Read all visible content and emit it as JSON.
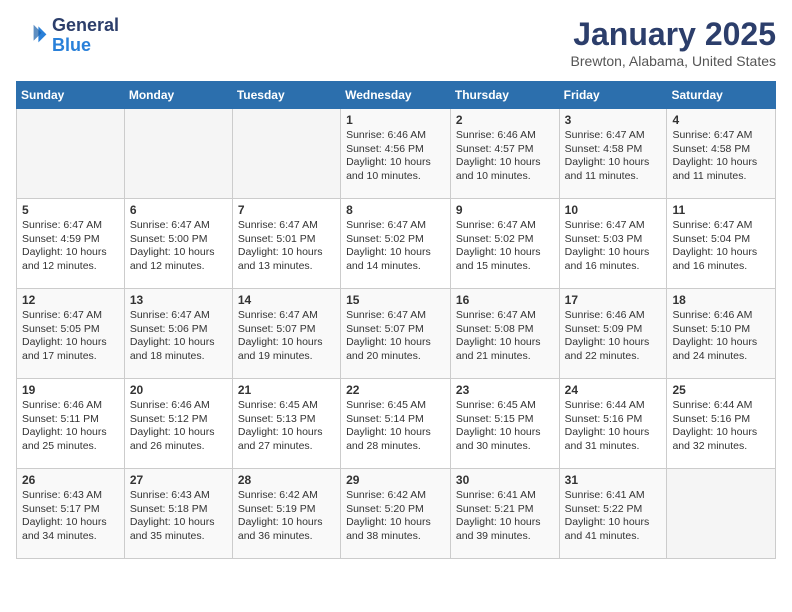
{
  "header": {
    "logo_general": "General",
    "logo_blue": "Blue",
    "month_title": "January 2025",
    "location": "Brewton, Alabama, United States"
  },
  "days_of_week": [
    "Sunday",
    "Monday",
    "Tuesday",
    "Wednesday",
    "Thursday",
    "Friday",
    "Saturday"
  ],
  "weeks": [
    [
      {
        "day": "",
        "info": ""
      },
      {
        "day": "",
        "info": ""
      },
      {
        "day": "",
        "info": ""
      },
      {
        "day": "1",
        "info": "Sunrise: 6:46 AM\nSunset: 4:56 PM\nDaylight: 10 hours and 10 minutes."
      },
      {
        "day": "2",
        "info": "Sunrise: 6:46 AM\nSunset: 4:57 PM\nDaylight: 10 hours and 10 minutes."
      },
      {
        "day": "3",
        "info": "Sunrise: 6:47 AM\nSunset: 4:58 PM\nDaylight: 10 hours and 11 minutes."
      },
      {
        "day": "4",
        "info": "Sunrise: 6:47 AM\nSunset: 4:58 PM\nDaylight: 10 hours and 11 minutes."
      }
    ],
    [
      {
        "day": "5",
        "info": "Sunrise: 6:47 AM\nSunset: 4:59 PM\nDaylight: 10 hours and 12 minutes."
      },
      {
        "day": "6",
        "info": "Sunrise: 6:47 AM\nSunset: 5:00 PM\nDaylight: 10 hours and 12 minutes."
      },
      {
        "day": "7",
        "info": "Sunrise: 6:47 AM\nSunset: 5:01 PM\nDaylight: 10 hours and 13 minutes."
      },
      {
        "day": "8",
        "info": "Sunrise: 6:47 AM\nSunset: 5:02 PM\nDaylight: 10 hours and 14 minutes."
      },
      {
        "day": "9",
        "info": "Sunrise: 6:47 AM\nSunset: 5:02 PM\nDaylight: 10 hours and 15 minutes."
      },
      {
        "day": "10",
        "info": "Sunrise: 6:47 AM\nSunset: 5:03 PM\nDaylight: 10 hours and 16 minutes."
      },
      {
        "day": "11",
        "info": "Sunrise: 6:47 AM\nSunset: 5:04 PM\nDaylight: 10 hours and 16 minutes."
      }
    ],
    [
      {
        "day": "12",
        "info": "Sunrise: 6:47 AM\nSunset: 5:05 PM\nDaylight: 10 hours and 17 minutes."
      },
      {
        "day": "13",
        "info": "Sunrise: 6:47 AM\nSunset: 5:06 PM\nDaylight: 10 hours and 18 minutes."
      },
      {
        "day": "14",
        "info": "Sunrise: 6:47 AM\nSunset: 5:07 PM\nDaylight: 10 hours and 19 minutes."
      },
      {
        "day": "15",
        "info": "Sunrise: 6:47 AM\nSunset: 5:07 PM\nDaylight: 10 hours and 20 minutes."
      },
      {
        "day": "16",
        "info": "Sunrise: 6:47 AM\nSunset: 5:08 PM\nDaylight: 10 hours and 21 minutes."
      },
      {
        "day": "17",
        "info": "Sunrise: 6:46 AM\nSunset: 5:09 PM\nDaylight: 10 hours and 22 minutes."
      },
      {
        "day": "18",
        "info": "Sunrise: 6:46 AM\nSunset: 5:10 PM\nDaylight: 10 hours and 24 minutes."
      }
    ],
    [
      {
        "day": "19",
        "info": "Sunrise: 6:46 AM\nSunset: 5:11 PM\nDaylight: 10 hours and 25 minutes."
      },
      {
        "day": "20",
        "info": "Sunrise: 6:46 AM\nSunset: 5:12 PM\nDaylight: 10 hours and 26 minutes."
      },
      {
        "day": "21",
        "info": "Sunrise: 6:45 AM\nSunset: 5:13 PM\nDaylight: 10 hours and 27 minutes."
      },
      {
        "day": "22",
        "info": "Sunrise: 6:45 AM\nSunset: 5:14 PM\nDaylight: 10 hours and 28 minutes."
      },
      {
        "day": "23",
        "info": "Sunrise: 6:45 AM\nSunset: 5:15 PM\nDaylight: 10 hours and 30 minutes."
      },
      {
        "day": "24",
        "info": "Sunrise: 6:44 AM\nSunset: 5:16 PM\nDaylight: 10 hours and 31 minutes."
      },
      {
        "day": "25",
        "info": "Sunrise: 6:44 AM\nSunset: 5:16 PM\nDaylight: 10 hours and 32 minutes."
      }
    ],
    [
      {
        "day": "26",
        "info": "Sunrise: 6:43 AM\nSunset: 5:17 PM\nDaylight: 10 hours and 34 minutes."
      },
      {
        "day": "27",
        "info": "Sunrise: 6:43 AM\nSunset: 5:18 PM\nDaylight: 10 hours and 35 minutes."
      },
      {
        "day": "28",
        "info": "Sunrise: 6:42 AM\nSunset: 5:19 PM\nDaylight: 10 hours and 36 minutes."
      },
      {
        "day": "29",
        "info": "Sunrise: 6:42 AM\nSunset: 5:20 PM\nDaylight: 10 hours and 38 minutes."
      },
      {
        "day": "30",
        "info": "Sunrise: 6:41 AM\nSunset: 5:21 PM\nDaylight: 10 hours and 39 minutes."
      },
      {
        "day": "31",
        "info": "Sunrise: 6:41 AM\nSunset: 5:22 PM\nDaylight: 10 hours and 41 minutes."
      },
      {
        "day": "",
        "info": ""
      }
    ]
  ]
}
